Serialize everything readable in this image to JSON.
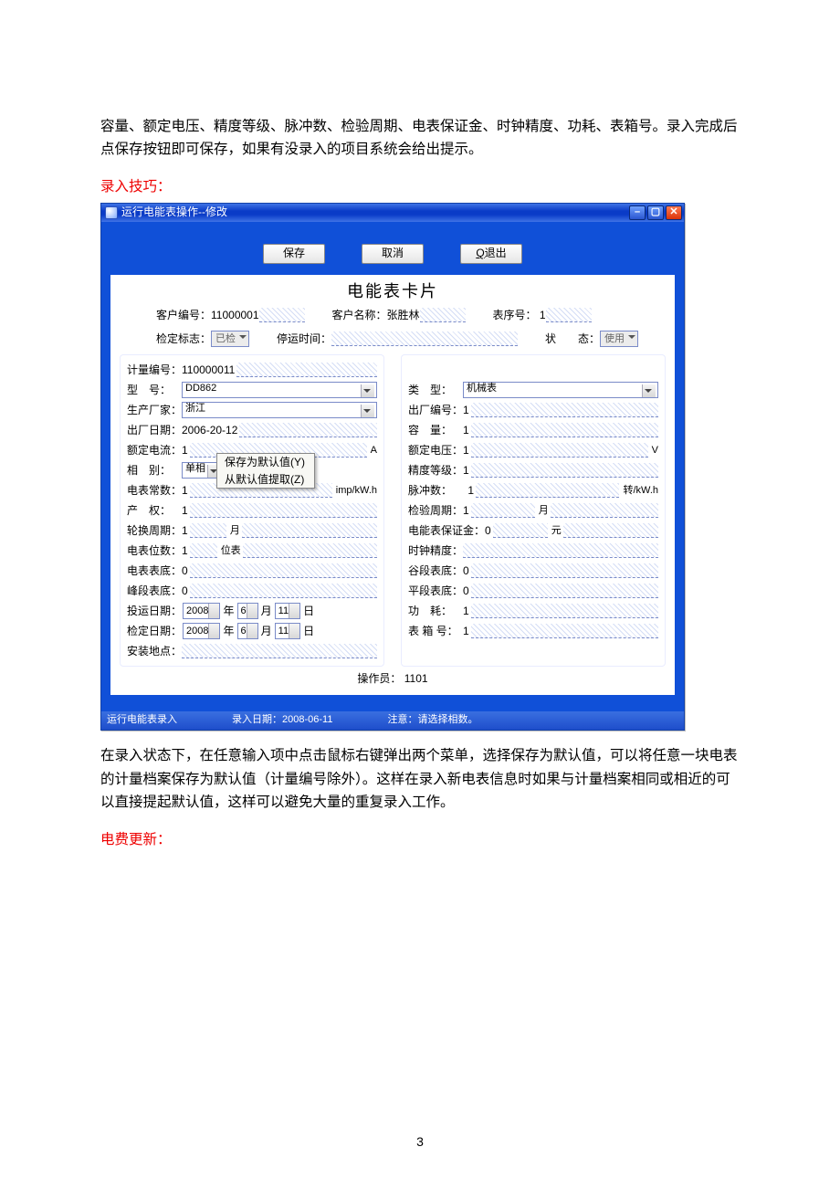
{
  "intro_para": "容量、额定电压、精度等级、脉冲数、检验周期、电表保证金、时钟精度、功耗、表箱号。录入完成后点保存按钮即可保存，如果有没录入的项目系统会给出提示。",
  "tip_heading": "录入技巧：",
  "window": {
    "title": "运行电能表操作--修改",
    "buttons": {
      "save": "保存",
      "cancel": "取消",
      "quit_u": "Q",
      "quit_rest": " 退出"
    }
  },
  "card": {
    "title": "电能表卡片",
    "cust_no_label": "客户编号：",
    "cust_no": "11000001",
    "cust_name_label": "客户名称：",
    "cust_name": "张胜林",
    "seq_label": "表序号：",
    "seq": "1",
    "check_flag_label": "检定标志：",
    "check_flag": "已检",
    "stop_label": "停运时间：",
    "state_label": "状　　态：",
    "state": "使用"
  },
  "left": {
    "meter_no_label": "计量编号：",
    "meter_no": "110000011",
    "model_label": "型　号：",
    "model": "DD862",
    "mfr_label": "生产厂家：",
    "mfr": "浙江",
    "out_date_label": "出厂日期：",
    "out_date": "2006-20-12",
    "rated_i_label": "额定电流：",
    "rated_i": "1",
    "rated_i_unit": "A",
    "phase_label": "相　别：",
    "phase": "单相",
    "const_label": "电表常数：",
    "const": "1",
    "const_unit": "imp/kW.h",
    "owner_label": "产　权：",
    "owner": "1",
    "rotate_label": "轮换周期：",
    "rotate": "1",
    "rotate_unit": "月",
    "digits_label": "电表位数：",
    "digits": "1",
    "digits_unit": "位表",
    "base_label": "电表表底：",
    "base": "0",
    "peak_label": "峰段表底：",
    "peak": "0",
    "run_date_label": "投运日期：",
    "chk_date_label": "检定日期：",
    "install_label": "安装地点：",
    "date_parts": {
      "y": "2008",
      "m": "6",
      "d": "11",
      "yl": "年",
      "ml": "月",
      "dl": "日"
    }
  },
  "right": {
    "type_label": "类　型：",
    "type": "机械表",
    "fac_no_label": "出厂编号：",
    "fac_no": "1",
    "cap_label": "容　量：",
    "cap": "1",
    "rated_v_label": "额定电压：",
    "rated_v": "1",
    "rated_v_unit": "V",
    "acc_label": "精度等级：",
    "acc": "1",
    "pulse_label": "脉冲数：",
    "pulse": "1",
    "pulse_unit": "转/kW.h",
    "chk_cycle_label": "检验周期：",
    "chk_cycle": "1",
    "chk_cycle_unit": "月",
    "deposit_label": "电能表保证金：",
    "deposit": "0",
    "deposit_unit": "元",
    "clock_label": "时钟精度：",
    "valley_label": "谷段表底：",
    "valley": "0",
    "flat_label": "平段表底：",
    "flat": "0",
    "power_label": "功　耗：",
    "power": "1",
    "box_label": "表 箱 号：",
    "box": "1"
  },
  "ctx_menu": {
    "a": "保存为默认值(Y)",
    "b": "从默认值提取(Z)"
  },
  "operator_label": "操作员：",
  "operator": "1101",
  "status": {
    "a": "运行电能表录入",
    "b_label": "录入日期：",
    "b_val": "2008-06-11",
    "c": "注意：请选择相数。"
  },
  "after_para": "在录入状态下，在任意输入项中点击鼠标右键弹出两个菜单，选择保存为默认值，可以将任意一块电表的计量档案保存为默认值（计量编号除外）。这样在录入新电表信息时如果与计量档案相同或相近的可以直接提起默认值，这样可以避免大量的重复录入工作。",
  "update_heading": "电费更新：",
  "page_number": "3"
}
